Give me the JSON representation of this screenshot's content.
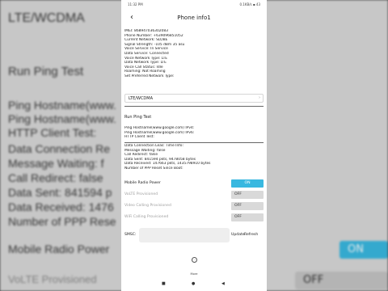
{
  "background": {
    "network": "LTE/WCDMA",
    "ping_title": "Run Ping Test",
    "lines": [
      "Ping Hostname(www.",
      "Ping Hostname(www.",
      "HTTP Client Test:",
      "Data Connection Re",
      "Message Waiting: f",
      "Call Redirect: false",
      "Data Sent: 841594 p",
      "Data Received: 1476",
      "Number of PPP Rese"
    ],
    "mobile_radio": "Mobile Radio Power",
    "mobile_radio_state": "ON",
    "volte": "VoLTE Provisioned",
    "volte_state": "OFF"
  },
  "status_bar": {
    "time": "11:32 PM",
    "indicators": "0.1KB/s ▪ 43"
  },
  "app_bar": {
    "title": "Phone info1"
  },
  "info_lines": [
    "IMEI: 868947036302083",
    "Phone Number: +639096851052",
    "Current Network: SLOBE",
    "Signal Strength: -105 dBm   35 asu",
    "Voice Service: In Service",
    "Data Service: Connected",
    "Voice Network Type: LTE",
    "Data Network Type: LTE",
    "Voice Call Status: Idle",
    "Roaming: Not Roaming",
    "Set Preferred Network Type:"
  ],
  "network_select": {
    "value": "LTE/WCDMA"
  },
  "ping": {
    "title": "Run Ping Test",
    "lines": [
      "Ping Hostname(www.google.com) IPv4:",
      "Ping Hostname(www.google.com) IPv6:",
      "HTTP Client Test:"
    ]
  },
  "connection_lines": [
    "Data Connection Leas: Time Info:",
    "Message Waiting: false",
    "Call Redirect: false",
    "Data Sent: 841594 pkts, 9478058 bytes",
    "Data Received: 147663 pkts, 1435798910 bytes",
    "Number of PPP Reset Since Boot:"
  ],
  "toggles": [
    {
      "label": "Mobile Radio Power",
      "state": "ON",
      "enabled": true
    },
    {
      "label": "VoLTE Provisioned",
      "state": "OFF",
      "enabled": false
    },
    {
      "label": "Video Calling Provisioned",
      "state": "OFF",
      "enabled": false
    },
    {
      "label": "WiFi Calling Provisioned",
      "state": "OFF",
      "enabled": false
    }
  ],
  "sms": {
    "label": "SMSC:",
    "update_label": "Update",
    "refresh_label": "Refresh"
  },
  "more": {
    "icon": "more-icon",
    "label": "More"
  },
  "navbar": {
    "recents": "■",
    "home": "●",
    "back": "◀"
  },
  "colors": {
    "toggle_on": "#39b8e0",
    "toggle_off": "#d9d9d9"
  }
}
